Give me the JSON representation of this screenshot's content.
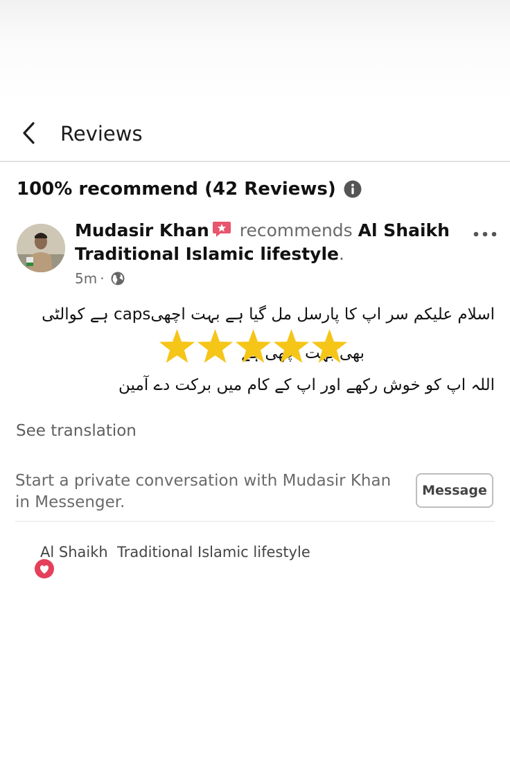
{
  "header": {
    "title": "Reviews"
  },
  "summary": {
    "text": "100% recommend (42 Reviews)"
  },
  "review": {
    "author": "Mudasir Khan",
    "verb": "recommends",
    "page_name": "Al Shaikh Traditional Islamic lifestyle",
    "page_suffix": ".",
    "time": "5m",
    "separator": "·",
    "audience_icon": "globe-icon",
    "badge_icon": "top-fan-badge-icon",
    "text_lines": [
      "اسلام علیکم سر اپ کا پارسل مل گیا ہے بہت اچھیcaps ہے کوالٹی",
      "بھی بہت اچھی ہے",
      "اللہ اپ کو خوش رکھے اور اپ کے کام میں برکت دے    آمین"
    ],
    "star_count": 5,
    "star_color": "#f5c518",
    "see_translation": "See translation"
  },
  "private_message": {
    "text": "Start a private conversation with Mudasir Khan in Messenger.",
    "button_label": "Message"
  },
  "footer": {
    "page_name": "Al Shaikh  Traditional Islamic lifestyle",
    "icon": "heart-recommend-icon",
    "icon_color": "#e4405a"
  }
}
